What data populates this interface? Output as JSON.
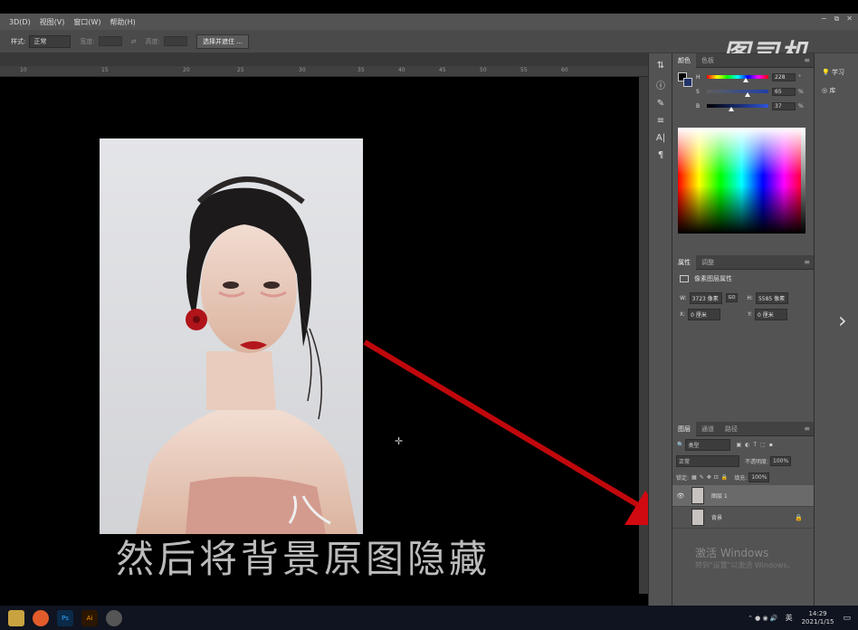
{
  "menu": {
    "items": [
      "3D(D)",
      "视图(V)",
      "窗口(W)",
      "帮助(H)"
    ]
  },
  "window_controls": {
    "minimize": "−",
    "restore": "⧉",
    "close": "✕"
  },
  "options_bar": {
    "style_label": "样式:",
    "style_value": "正常",
    "width_label": "宽度:",
    "height_label": "高度:",
    "select_mask_button": "选择并遮住 ..."
  },
  "ruler": {
    "ticks": [
      "10",
      "15",
      "20",
      "25",
      "30",
      "35",
      "40",
      "45",
      "50",
      "55",
      "60"
    ]
  },
  "logo": "图司机",
  "right_top": {
    "learn_label": "学习",
    "library_label": "库"
  },
  "color_panel": {
    "tabs": [
      "颜色",
      "色板"
    ],
    "H": {
      "label": "H",
      "value": "228",
      "unit": "°"
    },
    "S": {
      "label": "S",
      "value": "65",
      "unit": "%"
    },
    "B": {
      "label": "B",
      "value": "37",
      "unit": "%"
    },
    "colors": {
      "foreground": "#000000",
      "background": "#22336a"
    }
  },
  "properties_panel": {
    "tabs": [
      "属性",
      "调整"
    ],
    "title": "像素图层属性",
    "W_label": "W:",
    "W_value": "3723 像素",
    "H_label": "H:",
    "H_value": "5585 像素",
    "X_label": "X:",
    "X_value": "0 厘米",
    "Y_label": "Y:",
    "Y_value": "0 厘米",
    "link": "GO"
  },
  "layers_panel": {
    "tabs": [
      "图层",
      "通道",
      "路径"
    ],
    "filter_kind": "类型",
    "blend_mode": "正常",
    "opacity_label": "不透明度:",
    "opacity_value": "100%",
    "lock_label": "锁定:",
    "fill_label": "填充:",
    "fill_value": "100%",
    "layers": [
      {
        "name": "图层 1",
        "eye": "👁",
        "lock": ""
      },
      {
        "name": "背景",
        "eye": "",
        "lock": "🔒"
      }
    ]
  },
  "caption": "然后将背景原图隐藏",
  "watermark": {
    "line1": "激活 Windows",
    "line2": "转到\"设置\"以激活 Windows。"
  },
  "taskbar": {
    "apps": [
      "Ps",
      "Ai"
    ],
    "tray": {
      "ime": "英",
      "time": "14:29",
      "date": "2021/1/15"
    }
  }
}
